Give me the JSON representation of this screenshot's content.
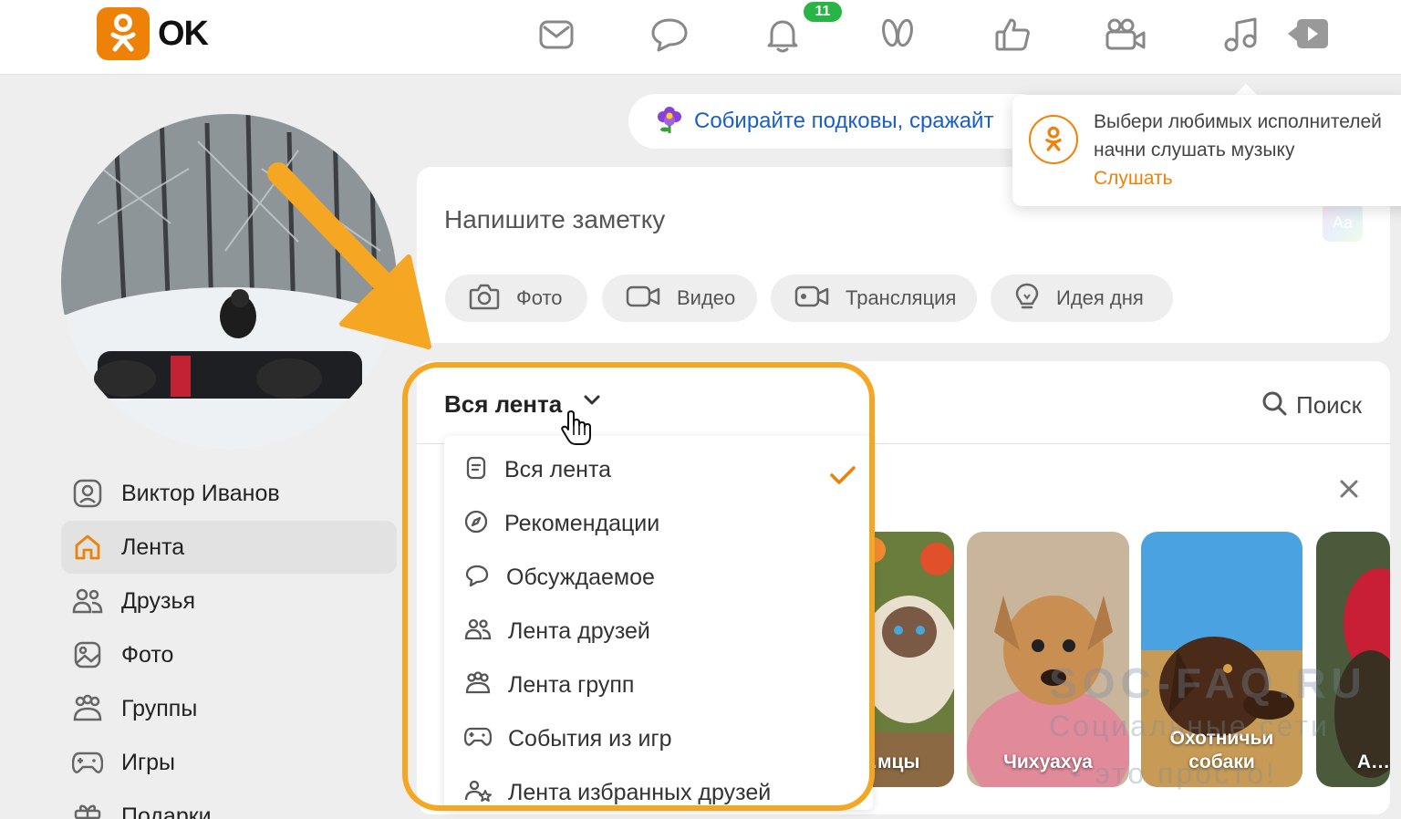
{
  "header": {
    "logo_text": "OK",
    "notifications_badge": "11",
    "nav_icons": [
      "messages-icon",
      "discussions-icon",
      "notifications-icon",
      "guests-icon",
      "likes-icon",
      "video-icon",
      "music-icon",
      "play-icon"
    ]
  },
  "colors": {
    "brand": "#ee8208",
    "badge": "#28b545",
    "link": "#1a5fc8",
    "highlight": "#f5a623"
  },
  "sidebar": {
    "items": [
      {
        "label": "Виктор Иванов",
        "icon": "user-icon"
      },
      {
        "label": "Лента",
        "icon": "home-icon",
        "active": true
      },
      {
        "label": "Друзья",
        "icon": "friends-icon"
      },
      {
        "label": "Фото",
        "icon": "photo-icon"
      },
      {
        "label": "Группы",
        "icon": "groups-icon"
      },
      {
        "label": "Игры",
        "icon": "games-icon"
      },
      {
        "label": "Подарки",
        "icon": "gift-icon"
      }
    ]
  },
  "promo": {
    "text": "Собирайте подковы, сражайт"
  },
  "music_popup": {
    "line1": "Выбери любимых исполнителей",
    "line2": "начни слушать музыку",
    "link": "Слушать"
  },
  "note": {
    "placeholder": "Напишите заметку",
    "font_button": "Aa",
    "buttons": [
      "Фото",
      "Видео",
      "Трансляция",
      "Идея дня"
    ]
  },
  "feed": {
    "filter_label": "Вся лента",
    "search_label": "Поиск",
    "tiles": [
      "…мцы",
      "Чихуахуа",
      "Охотничьи собаки",
      "А…"
    ]
  },
  "dropdown": {
    "items": [
      {
        "label": "Вся лента",
        "selected": true
      },
      {
        "label": "Рекомендации"
      },
      {
        "label": "Обсуждаемое"
      },
      {
        "label": "Лента друзей"
      },
      {
        "label": "Лента групп"
      },
      {
        "label": "События из игр"
      },
      {
        "label": "Лента избранных друзей"
      }
    ]
  },
  "watermark": {
    "line1": "SOC-FAQ.RU",
    "line2": "Социальные сети",
    "line3": "- это просто!"
  }
}
